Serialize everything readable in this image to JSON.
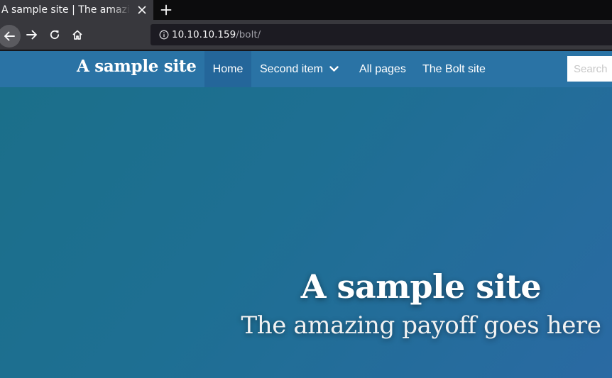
{
  "browser": {
    "tab": {
      "title": "A sample site | The amazing payoff goes here"
    },
    "url": {
      "host": "10.10.10.159",
      "path": "/bolt/"
    },
    "icons": {
      "back": "back-arrow-icon",
      "forward": "forward-arrow-icon",
      "reload": "reload-icon",
      "home": "home-icon",
      "info": "info-icon",
      "close": "close-icon",
      "new_tab": "plus-icon"
    }
  },
  "site": {
    "brand": "A sample site",
    "nav": {
      "items": [
        {
          "label": "Home",
          "active": true
        },
        {
          "label": "Second item",
          "has_dropdown": true
        },
        {
          "label": "All pages"
        },
        {
          "label": "The Bolt site"
        }
      ],
      "search_placeholder": "Search"
    },
    "hero": {
      "title": "A sample site",
      "subtitle": "The amazing payoff goes here"
    },
    "colors": {
      "navbar": "#2a73a5",
      "nav_active": "#24669a",
      "hero_start": "#1b6f8a",
      "hero_end": "#2a6aa3"
    }
  }
}
